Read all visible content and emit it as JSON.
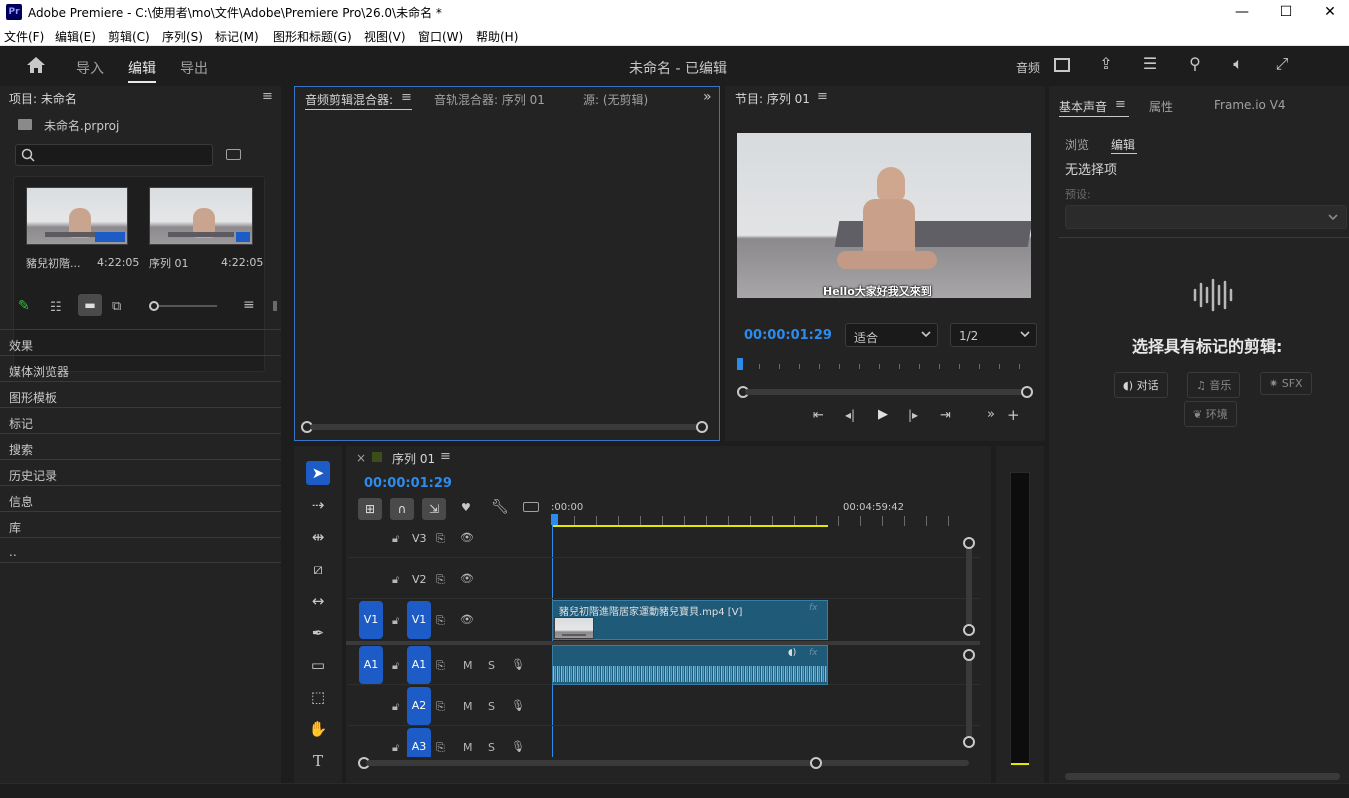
{
  "window": {
    "app_logo": "Pr",
    "title": "Adobe Premiere - C:\\使用者\\mo\\文件\\Adobe\\Premiere Pro\\26.0\\未命名 *",
    "minimize": "—",
    "maximize": "☐",
    "close": "✕"
  },
  "menu": [
    "文件(F)",
    "编辑(E)",
    "剪辑(C)",
    "序列(S)",
    "标记(M)",
    "图形和标题(G)",
    "视图(V)",
    "窗口(W)",
    "帮助(H)"
  ],
  "header": {
    "tabs": [
      "导入",
      "编辑",
      "导出"
    ],
    "active_tab": "编辑",
    "doc_title": "未命名 - 已编辑",
    "audio_label": "音频"
  },
  "project": {
    "title": "项目: 未命名",
    "file": "未命名.prproj",
    "search_placeholder": "",
    "items": [
      {
        "name": "豬兒初階...",
        "duration": "4:22:05"
      },
      {
        "name": "序列 01",
        "duration": "4:22:05"
      }
    ],
    "panels": [
      "效果",
      "媒体浏览器",
      "图形模板",
      "标记",
      "搜索",
      "历史记录",
      "信息",
      "库",
      ".."
    ]
  },
  "source": {
    "tabs": [
      "音频剪辑混合器:",
      "音轨混合器: 序列 01",
      "源: (无剪辑)"
    ],
    "more": "»"
  },
  "program": {
    "title": "节目: 序列 01",
    "timecode": "00:00:01:29",
    "fit": "适合",
    "resolution": "1/2",
    "subtitle": "Hello大家好我又來到"
  },
  "timeline": {
    "close": "×",
    "title": "序列 01",
    "timecode": "00:00:01:29",
    "ruler_start": ":00:00",
    "ruler_end": "00:04:59:42",
    "video_tracks": [
      "V3",
      "V2",
      "V1"
    ],
    "audio_tracks": [
      "A1",
      "A2",
      "A3"
    ],
    "src_v": "V1",
    "src_a": "A1",
    "mute": "M",
    "solo": "S",
    "video_clip": "豬兒初階進階居家運動豬兒寶貝.mp4 [V]",
    "fx": "fx"
  },
  "essential_sound": {
    "tabs": [
      "基本声音",
      "属性",
      "Frame.io V4"
    ],
    "subtabs": [
      "浏览",
      "编辑"
    ],
    "no_selection": "无选择项",
    "preset_label": "预设:",
    "heading": "选择具有标记的剪辑:",
    "types": [
      "对话",
      "音乐",
      "SFX",
      "环境"
    ]
  },
  "colors": {
    "accent": "#2d8ceb",
    "track_blue": "#1d5cc6",
    "clip_blue": "#1f5a79",
    "audio_clip": "#1f5a79",
    "playhead": "#2d8ceb",
    "workarea": "#e6e600"
  }
}
